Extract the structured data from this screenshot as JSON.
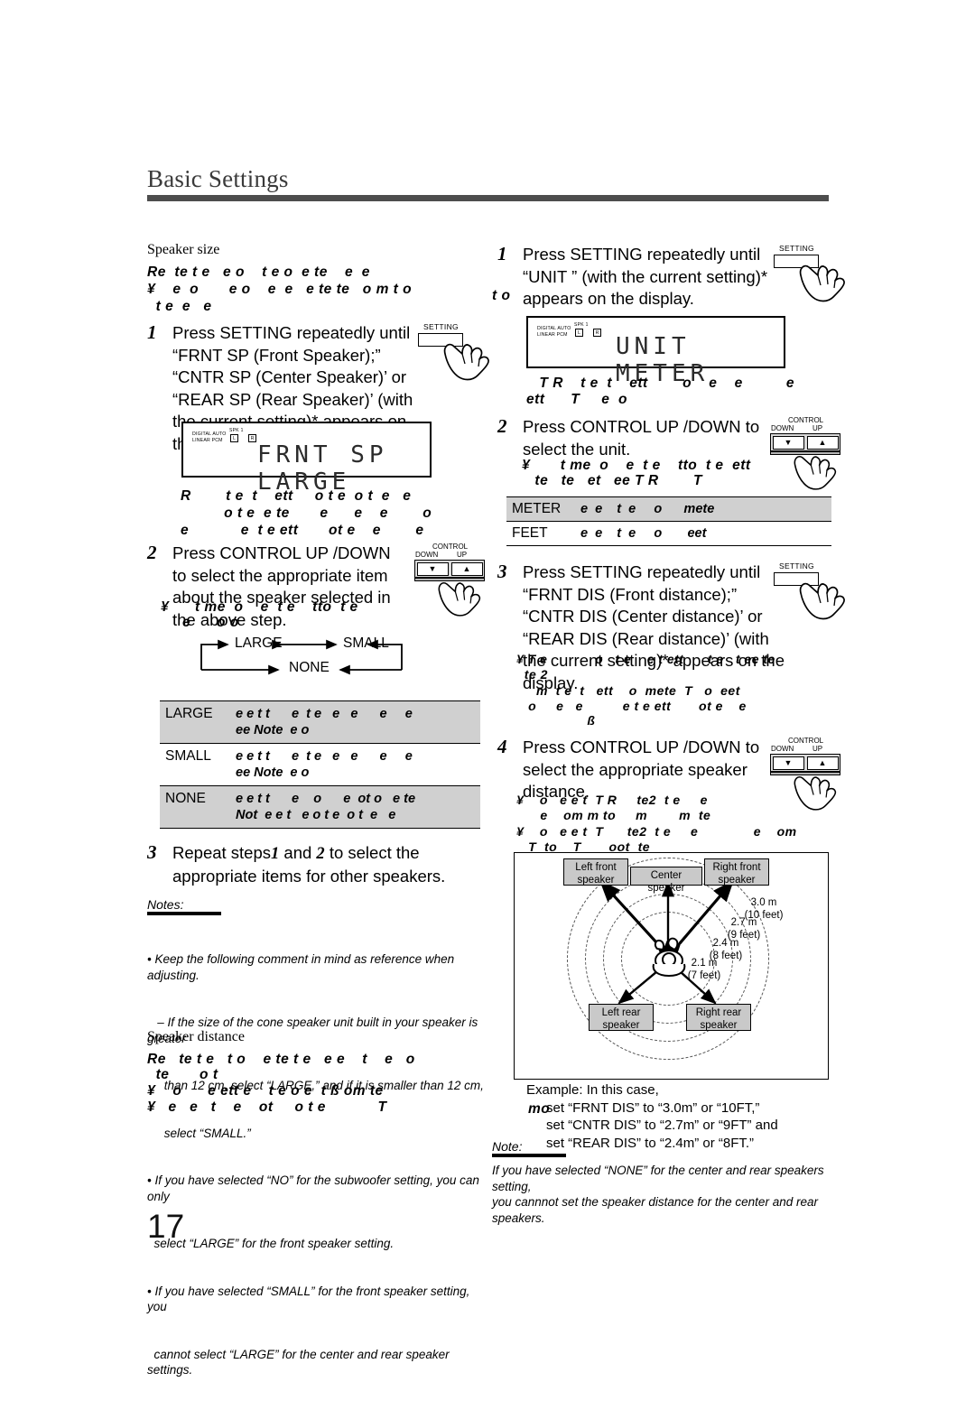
{
  "header": {
    "title": "Basic Settings"
  },
  "page_number": "17",
  "left_column": {
    "section1_label": "Speaker size",
    "section1_intro_ghost": [
      "Re  te t e   e o    t e o  e te    e  e",
      "¥    e  o       e o    e  e   e te te   o m t o",
      "  t e  e   e"
    ],
    "step1": {
      "num": "1",
      "text": "Press SETTING repeatedly until “FRNT SP (Front Speaker);” “CNTR SP (Center Speaker)’ or “REAR SP (Rear Speaker)’ (with the current setting)* appears on the display."
    },
    "display1": {
      "indicator_line1": "DIGITAL AUTO",
      "indicator_line2": "LINEAR PCM",
      "spk_label": "SPK 1",
      "icon_left": "L",
      "icon_right": "R",
      "text": "FRNT SP LARGE"
    },
    "after_display1_ghost": [
      "R        t e  t    ett     o t e  o t  e   e",
      "          o t e  e te       e      e    e        o",
      "e            e  t e ett       ot e    e        e"
    ],
    "step2": {
      "num": "2",
      "text": "Press CONTROL UP /DOWN to select the appropriate item about the speaker selected in the above step."
    },
    "step2_ghost": [
      "¥      t me  o    e  t e    tto  t e",
      "     e      o o"
    ],
    "flow": {
      "large": "LARGE",
      "small": "SMALL",
      "none": "NONE"
    },
    "size_table": [
      {
        "key": "LARGE",
        "value": "e e t t      e  t e   e   e      e     e\nee Note  e o"
      },
      {
        "key": "SMALL",
        "value": "e e t t      e  t e   e   e      e     e\nee Note  e o"
      },
      {
        "key": "NONE",
        "value": "e e t t      e    o      e  ot o   e te\nNot  e e t   e o t e  o t  e   e"
      }
    ],
    "step3": {
      "num": "3",
      "text_pre": "Repeat steps",
      "text_a": "1",
      "text_mid": "and",
      "text_b": "2",
      "text_post": "to select the appropriate items for other speakers."
    },
    "notes_heading": "Notes:",
    "notes": [
      "• Keep the following comment in mind as reference when adjusting.",
      "   – If the size of the cone speaker unit built in your speaker is greater",
      "     than 12 cm, select “LARGE,” and if it is smaller than 12 cm,",
      "     select “SMALL.”",
      "• If you have selected “NO” for the subwoofer setting, you can only",
      "  select “LARGE” for the front speaker setting.",
      "• If you have selected “SMALL” for the front speaker setting, you",
      "  cannot select “LARGE” for the center and rear speaker settings."
    ],
    "section2_label": "Speaker distance",
    "section2_intro_ghost": [
      "Re   te t e   t o    e te t e   e e    t    e   o",
      "  te       o t",
      "¥    o      e ett e    t e o e  t ß om te",
      "¥   e   e   t    e    ot     o t e            T"
    ]
  },
  "right_column": {
    "step1": {
      "num": "1",
      "text": "Press SETTING repeatedly until “UNIT ” (with the current setting)* appears on the display."
    },
    "overlap_ghost_1": "t o",
    "display2": {
      "indicator_line1": "DIGITAL AUTO",
      "indicator_line2": "LINEAR PCM",
      "spk_label": "SPK 1",
      "icon_left": "L",
      "icon_right": "R",
      "text": "UNIT  METER"
    },
    "after_display2_ghost": [
      "   T R    t e  t    ett        o    e    e          e",
      "ett      T     e  o"
    ],
    "step2": {
      "num": "2",
      "text": "Press CONTROL UP /DOWN to select the unit."
    },
    "step2_ghost": [
      "¥       t me  o    e  t e    tto  t e  ett",
      "   te   te   et   ee T R        T"
    ],
    "unit_table": [
      {
        "key": "METER",
        "value": "e  e    t  e     o      mete"
      },
      {
        "key": "FEET",
        "value": "e  e    t  e     o       eet"
      }
    ],
    "step3": {
      "num": "3",
      "text": "Press SETTING repeatedly until “FRNT DIS (Front distance);” “CNTR DIS (Center distance)’ or “REAR DIS (Rear distance)’ (with the current setting)* appears on the display."
    },
    "step3_ghost": [
      "¥ T e            o   t e    e t ett      t e   t ee te",
      "  te 2",
      "     m  t e  t   ett    o  mete  T   o  eet",
      "   o     e   e          e t e ett       ot e    e",
      "                        ß"
    ],
    "step4": {
      "num": "4",
      "text": "Press CONTROL UP /DOWN to select the appropriate speaker distance."
    },
    "step4_ghost": [
      "¥    o   e e t  T R     te2  t e     e",
      "      e    om m to     m        m  te",
      "¥    o   e e t  T      te2  t e     e              e    om",
      "   T  to    T       oot  te"
    ],
    "diagram": {
      "left_front": "Left front\nspeaker",
      "center": "Center speaker",
      "right_front": "Right front\nspeaker",
      "left_rear": "Left rear\nspeaker",
      "right_rear": "Right rear\nspeaker",
      "distances": [
        "3.0 m\n(10 feet)",
        "2.7 m\n(9 feet)",
        "2.4 m\n(8 feet)",
        "2.1 m\n(7 feet)"
      ]
    },
    "example": [
      "Example: In this case,",
      "set “FRNT DIS” to “3.0m” or “10FT,”",
      "set “CNTR DIS” to “2.7m” or “9FT” and",
      "set “REAR DIS” to “2.4m” or “8FT.”"
    ],
    "example_ghost": "mo",
    "note_heading": "Note:",
    "note_body": "If you have selected “NONE” for the center and rear speakers setting,\nyou cannnot set the speaker distance for the center and rear\nspeakers."
  },
  "buttons": {
    "setting_caption": "SETTING",
    "control_caption": "CONTROL",
    "control_down": "DOWN",
    "control_up": "UP",
    "down_glyph": "▼",
    "up_glyph": "▲"
  }
}
